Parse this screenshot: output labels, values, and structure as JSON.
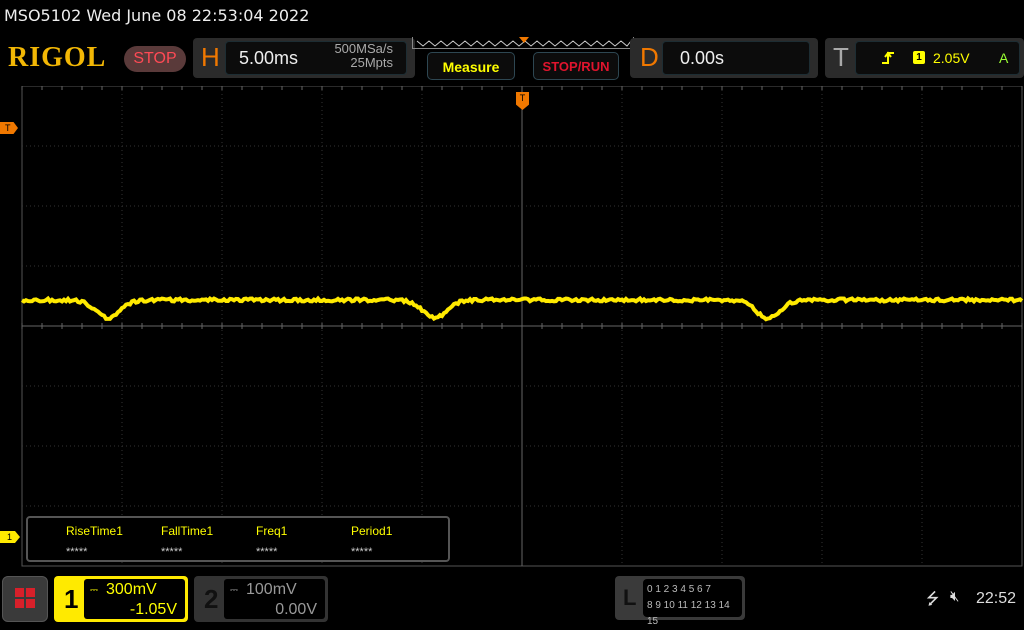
{
  "title": "MSO5102  Wed June 08 22:53:04 2022",
  "logo": "RIGOL",
  "run_state": "STOP",
  "horizontal": {
    "letter": "H",
    "timebase": "5.00ms",
    "sample_rate": "500MSa/s",
    "memory_depth": "25Mpts"
  },
  "buttons": {
    "measure": "Measure",
    "stop_run": "STOP/RUN"
  },
  "delay": {
    "letter": "D",
    "value": "0.00s"
  },
  "trigger": {
    "letter": "T",
    "slope": "rising-edge-icon",
    "source": "1",
    "level": "2.05V",
    "mode": "A"
  },
  "markers": {
    "trigger_level": "T",
    "channel1": "1",
    "trigger_pos": "T"
  },
  "measurements": [
    {
      "name": "RiseTime1",
      "value": "*****"
    },
    {
      "name": "FallTime1",
      "value": "*****"
    },
    {
      "name": "Freq1",
      "value": "*****"
    },
    {
      "name": "Period1",
      "value": "*****"
    }
  ],
  "channels": [
    {
      "num": "1",
      "scale": "300mV",
      "offset": "-1.05V",
      "coupling": "dc-icon",
      "color": "#ffea00"
    },
    {
      "num": "2",
      "scale": "100mV",
      "offset": "0.00V",
      "coupling": "dc-icon",
      "color": "#999999"
    }
  ],
  "logic": {
    "letter": "L",
    "row1": "0 1 2 3  4 5 6 7",
    "row2": "8 9 10 11 12 13 14 15"
  },
  "status": {
    "usb": "usb-icon",
    "sound": "mute-icon",
    "clock": "22:52"
  },
  "trace": {
    "color": "#ffea00",
    "level_v": 1.18,
    "dip_v": 1.09,
    "dip_times_ms": [
      -20.7,
      -4.35,
      12.3
    ]
  }
}
